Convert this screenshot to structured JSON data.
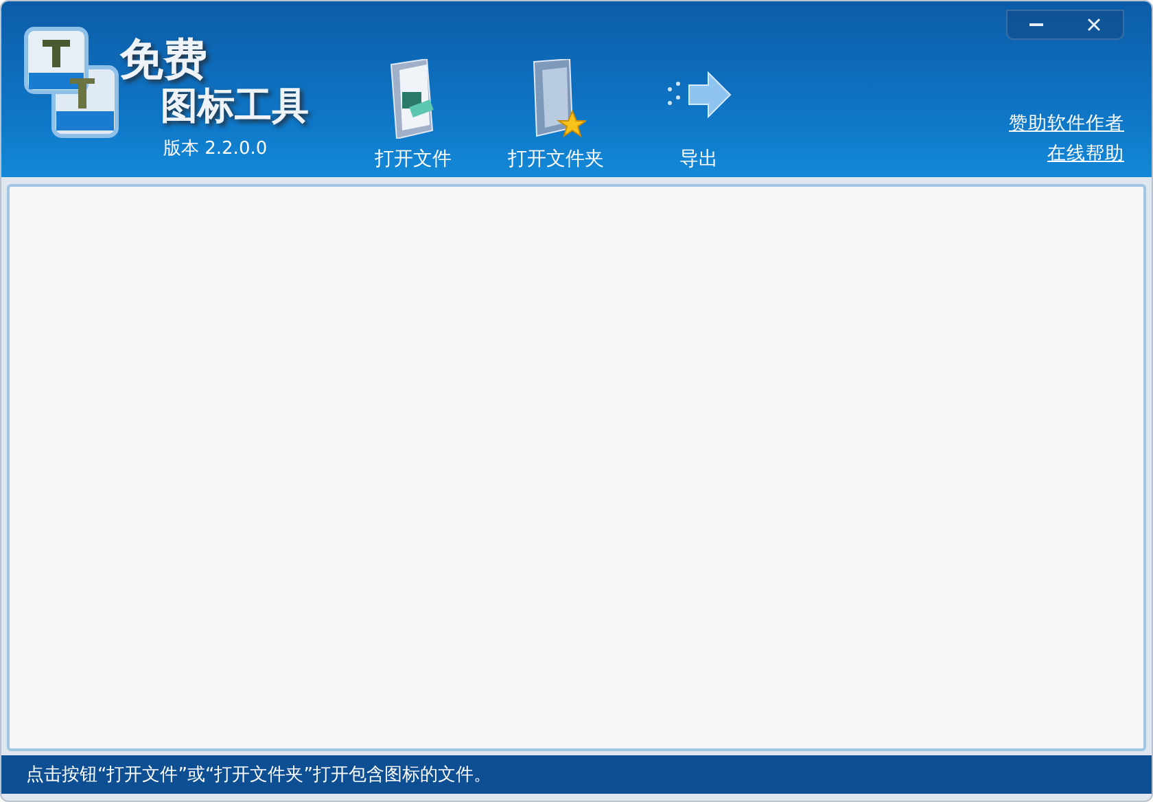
{
  "app": {
    "logo_title": "免费",
    "logo_subtitle": "图标工具",
    "version": "版本 2.2.0.0"
  },
  "toolbar": [
    {
      "kind": "open-file",
      "label": "打开文件"
    },
    {
      "kind": "open-folder",
      "label": "打开文件夹"
    },
    {
      "kind": "export",
      "label": "导出"
    }
  ],
  "links": [
    "赞助软件作者",
    "在线帮助"
  ],
  "status_bar": {
    "text": "点击按钮“打开文件”或“打开文件夹”打开包含图标的文件。"
  }
}
